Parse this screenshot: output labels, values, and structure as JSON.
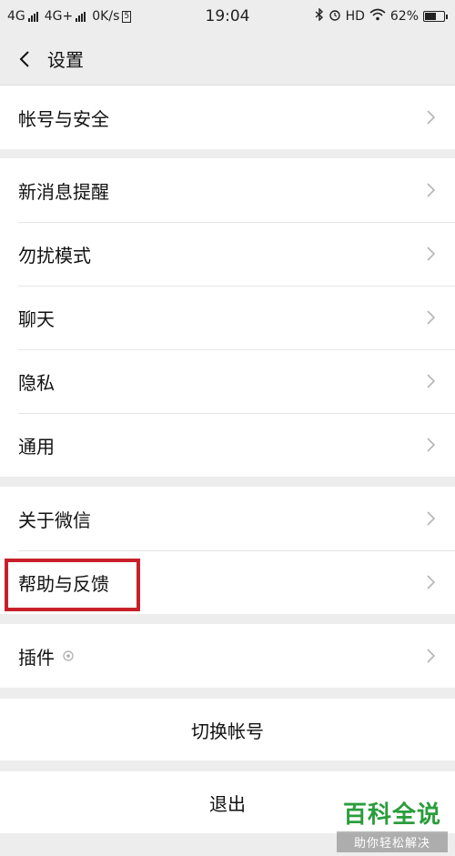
{
  "status_bar": {
    "network1": "4G",
    "network2": "4G+",
    "speed": "0K/s",
    "sim_badge": "5",
    "time": "19:04",
    "hd_label": "HD",
    "battery": "62%",
    "battery_level": 0.62
  },
  "nav": {
    "title": "设置"
  },
  "groups": [
    {
      "items": [
        {
          "label": "帐号与安全"
        }
      ]
    },
    {
      "items": [
        {
          "label": "新消息提醒"
        },
        {
          "label": "勿扰模式"
        },
        {
          "label": "聊天"
        },
        {
          "label": "隐私"
        },
        {
          "label": "通用"
        }
      ]
    },
    {
      "items": [
        {
          "label": "关于微信"
        },
        {
          "label": "帮助与反馈"
        }
      ]
    },
    {
      "items": [
        {
          "label": "插件"
        }
      ]
    }
  ],
  "actions": {
    "switch_account": "切换帐号",
    "logout": "退出"
  },
  "watermark": {
    "title": "百科全说",
    "subtitle": "助你轻松解决"
  },
  "colors": {
    "background": "#ededed",
    "highlight": "#c8202a",
    "watermark_green": "#2a9d3c"
  }
}
